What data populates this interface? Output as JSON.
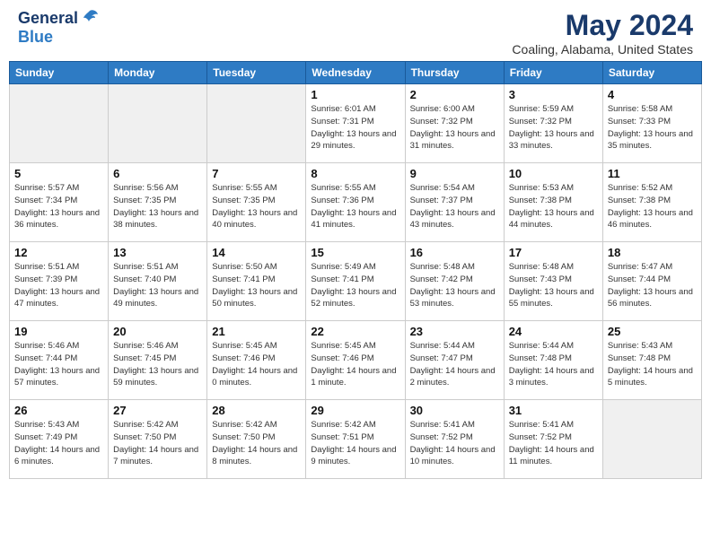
{
  "header": {
    "logo_line1": "General",
    "logo_line2": "Blue",
    "main_title": "May 2024",
    "subtitle": "Coaling, Alabama, United States"
  },
  "calendar": {
    "days": [
      "Sunday",
      "Monday",
      "Tuesday",
      "Wednesday",
      "Thursday",
      "Friday",
      "Saturday"
    ],
    "weeks": [
      {
        "cells": [
          {
            "date": "",
            "empty": true
          },
          {
            "date": "",
            "empty": true
          },
          {
            "date": "",
            "empty": true
          },
          {
            "date": "1",
            "sunrise": "Sunrise: 6:01 AM",
            "sunset": "Sunset: 7:31 PM",
            "daylight": "Daylight: 13 hours and 29 minutes."
          },
          {
            "date": "2",
            "sunrise": "Sunrise: 6:00 AM",
            "sunset": "Sunset: 7:32 PM",
            "daylight": "Daylight: 13 hours and 31 minutes."
          },
          {
            "date": "3",
            "sunrise": "Sunrise: 5:59 AM",
            "sunset": "Sunset: 7:32 PM",
            "daylight": "Daylight: 13 hours and 33 minutes."
          },
          {
            "date": "4",
            "sunrise": "Sunrise: 5:58 AM",
            "sunset": "Sunset: 7:33 PM",
            "daylight": "Daylight: 13 hours and 35 minutes."
          }
        ]
      },
      {
        "cells": [
          {
            "date": "5",
            "sunrise": "Sunrise: 5:57 AM",
            "sunset": "Sunset: 7:34 PM",
            "daylight": "Daylight: 13 hours and 36 minutes."
          },
          {
            "date": "6",
            "sunrise": "Sunrise: 5:56 AM",
            "sunset": "Sunset: 7:35 PM",
            "daylight": "Daylight: 13 hours and 38 minutes."
          },
          {
            "date": "7",
            "sunrise": "Sunrise: 5:55 AM",
            "sunset": "Sunset: 7:35 PM",
            "daylight": "Daylight: 13 hours and 40 minutes."
          },
          {
            "date": "8",
            "sunrise": "Sunrise: 5:55 AM",
            "sunset": "Sunset: 7:36 PM",
            "daylight": "Daylight: 13 hours and 41 minutes."
          },
          {
            "date": "9",
            "sunrise": "Sunrise: 5:54 AM",
            "sunset": "Sunset: 7:37 PM",
            "daylight": "Daylight: 13 hours and 43 minutes."
          },
          {
            "date": "10",
            "sunrise": "Sunrise: 5:53 AM",
            "sunset": "Sunset: 7:38 PM",
            "daylight": "Daylight: 13 hours and 44 minutes."
          },
          {
            "date": "11",
            "sunrise": "Sunrise: 5:52 AM",
            "sunset": "Sunset: 7:38 PM",
            "daylight": "Daylight: 13 hours and 46 minutes."
          }
        ]
      },
      {
        "cells": [
          {
            "date": "12",
            "sunrise": "Sunrise: 5:51 AM",
            "sunset": "Sunset: 7:39 PM",
            "daylight": "Daylight: 13 hours and 47 minutes."
          },
          {
            "date": "13",
            "sunrise": "Sunrise: 5:51 AM",
            "sunset": "Sunset: 7:40 PM",
            "daylight": "Daylight: 13 hours and 49 minutes."
          },
          {
            "date": "14",
            "sunrise": "Sunrise: 5:50 AM",
            "sunset": "Sunset: 7:41 PM",
            "daylight": "Daylight: 13 hours and 50 minutes."
          },
          {
            "date": "15",
            "sunrise": "Sunrise: 5:49 AM",
            "sunset": "Sunset: 7:41 PM",
            "daylight": "Daylight: 13 hours and 52 minutes."
          },
          {
            "date": "16",
            "sunrise": "Sunrise: 5:48 AM",
            "sunset": "Sunset: 7:42 PM",
            "daylight": "Daylight: 13 hours and 53 minutes."
          },
          {
            "date": "17",
            "sunrise": "Sunrise: 5:48 AM",
            "sunset": "Sunset: 7:43 PM",
            "daylight": "Daylight: 13 hours and 55 minutes."
          },
          {
            "date": "18",
            "sunrise": "Sunrise: 5:47 AM",
            "sunset": "Sunset: 7:44 PM",
            "daylight": "Daylight: 13 hours and 56 minutes."
          }
        ]
      },
      {
        "cells": [
          {
            "date": "19",
            "sunrise": "Sunrise: 5:46 AM",
            "sunset": "Sunset: 7:44 PM",
            "daylight": "Daylight: 13 hours and 57 minutes."
          },
          {
            "date": "20",
            "sunrise": "Sunrise: 5:46 AM",
            "sunset": "Sunset: 7:45 PM",
            "daylight": "Daylight: 13 hours and 59 minutes."
          },
          {
            "date": "21",
            "sunrise": "Sunrise: 5:45 AM",
            "sunset": "Sunset: 7:46 PM",
            "daylight": "Daylight: 14 hours and 0 minutes."
          },
          {
            "date": "22",
            "sunrise": "Sunrise: 5:45 AM",
            "sunset": "Sunset: 7:46 PM",
            "daylight": "Daylight: 14 hours and 1 minute."
          },
          {
            "date": "23",
            "sunrise": "Sunrise: 5:44 AM",
            "sunset": "Sunset: 7:47 PM",
            "daylight": "Daylight: 14 hours and 2 minutes."
          },
          {
            "date": "24",
            "sunrise": "Sunrise: 5:44 AM",
            "sunset": "Sunset: 7:48 PM",
            "daylight": "Daylight: 14 hours and 3 minutes."
          },
          {
            "date": "25",
            "sunrise": "Sunrise: 5:43 AM",
            "sunset": "Sunset: 7:48 PM",
            "daylight": "Daylight: 14 hours and 5 minutes."
          }
        ]
      },
      {
        "cells": [
          {
            "date": "26",
            "sunrise": "Sunrise: 5:43 AM",
            "sunset": "Sunset: 7:49 PM",
            "daylight": "Daylight: 14 hours and 6 minutes."
          },
          {
            "date": "27",
            "sunrise": "Sunrise: 5:42 AM",
            "sunset": "Sunset: 7:50 PM",
            "daylight": "Daylight: 14 hours and 7 minutes."
          },
          {
            "date": "28",
            "sunrise": "Sunrise: 5:42 AM",
            "sunset": "Sunset: 7:50 PM",
            "daylight": "Daylight: 14 hours and 8 minutes."
          },
          {
            "date": "29",
            "sunrise": "Sunrise: 5:42 AM",
            "sunset": "Sunset: 7:51 PM",
            "daylight": "Daylight: 14 hours and 9 minutes."
          },
          {
            "date": "30",
            "sunrise": "Sunrise: 5:41 AM",
            "sunset": "Sunset: 7:52 PM",
            "daylight": "Daylight: 14 hours and 10 minutes."
          },
          {
            "date": "31",
            "sunrise": "Sunrise: 5:41 AM",
            "sunset": "Sunset: 7:52 PM",
            "daylight": "Daylight: 14 hours and 11 minutes."
          },
          {
            "date": "",
            "empty": true
          }
        ]
      }
    ]
  }
}
